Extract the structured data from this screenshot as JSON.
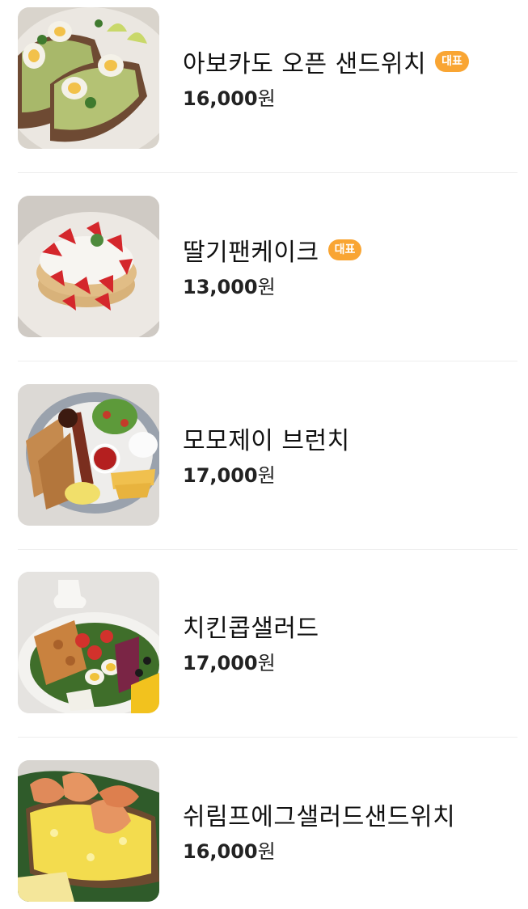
{
  "items": [
    {
      "name": "아보카도 오픈 샌드위치",
      "badge": "대표",
      "price": "16,000",
      "unit": "원"
    },
    {
      "name": "딸기팬케이크",
      "badge": "대표",
      "price": "13,000",
      "unit": "원"
    },
    {
      "name": "모모제이 브런치",
      "price": "17,000",
      "unit": "원"
    },
    {
      "name": "치킨콥샐러드",
      "price": "17,000",
      "unit": "원"
    },
    {
      "name": "쉬림프에그샐러드샌드위치",
      "price": "16,000",
      "unit": "원"
    }
  ],
  "colors": {
    "badge": "#f9a533",
    "divider": "#eeeeee",
    "text": "#111111"
  }
}
